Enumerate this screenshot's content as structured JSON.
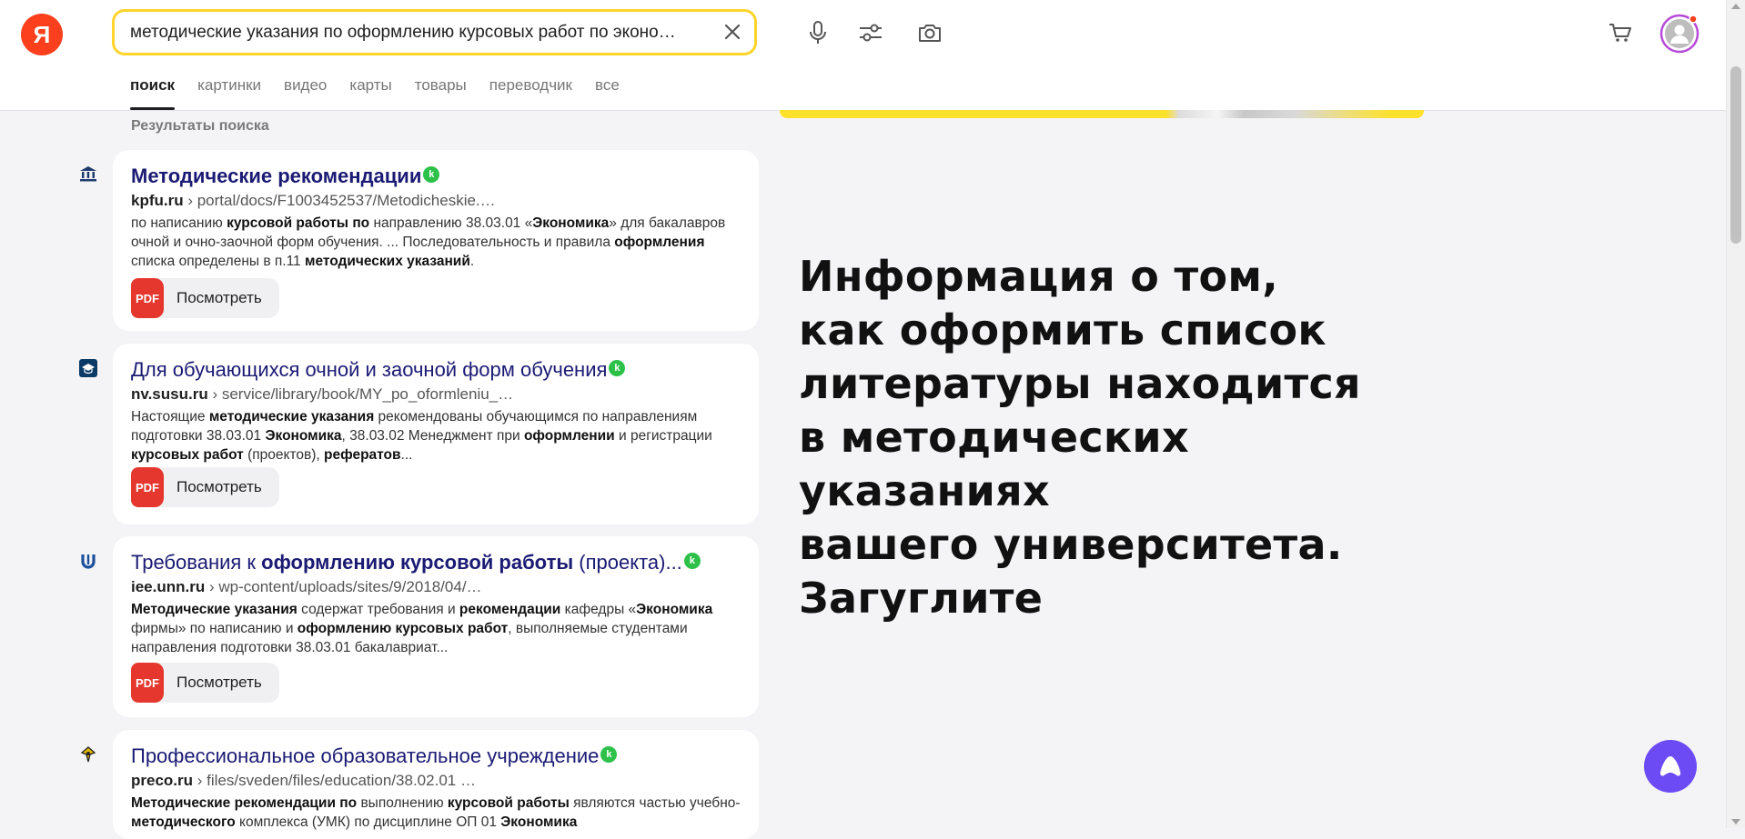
{
  "header": {
    "logo_letter": "Я",
    "search_query": "методические указания по оформлению курсовых работ по эконо…",
    "tabs": [
      "поиск",
      "картинки",
      "видео",
      "карты",
      "товары",
      "переводчик",
      "все"
    ],
    "active_tab": "поиск"
  },
  "results": {
    "heading": "Результаты поиска",
    "view_label": "Посмотреть",
    "pdf_label": "PDF",
    "badge_letter": "k",
    "items": [
      {
        "title": "Методические рекомендации",
        "domain": "kpfu.ru",
        "path": "› portal/docs/F1003452537/Metodicheskie.…",
        "snippet_parts": [
          [
            "",
            "по написанию "
          ],
          [
            "b",
            "курсовой работы по"
          ],
          [
            "",
            " направлению 38.03.01 «"
          ],
          [
            "b",
            "Экономика"
          ],
          [
            "",
            "» для бакалавров очной и очно-заочной форм обучения. ... Последовательность и правила "
          ],
          [
            "b",
            "оформления"
          ],
          [
            "",
            " списка определены в п.11 "
          ],
          [
            "b",
            "методических указаний"
          ],
          [
            "",
            "."
          ]
        ]
      },
      {
        "title": "Для обучающихся очной и заочной форм обучения",
        "domain": "nv.susu.ru",
        "path": "› service/library/book/MY_po_oformleniu_…",
        "snippet_parts": [
          [
            "",
            "Настоящие "
          ],
          [
            "b",
            "методические указания"
          ],
          [
            "",
            " рекомендованы обучающимся по направлениям подготовки 38.03.01 "
          ],
          [
            "b",
            "Экономика"
          ],
          [
            "",
            ", 38.03.02 Менеджмент при "
          ],
          [
            "b",
            "оформлении"
          ],
          [
            "",
            " и регистрации "
          ],
          [
            "b",
            "курсовых работ"
          ],
          [
            "",
            " (проектов), "
          ],
          [
            "b",
            "рефератов"
          ],
          [
            "",
            "..."
          ]
        ]
      },
      {
        "title_parts": [
          [
            "",
            "Требования к "
          ],
          [
            "b",
            "оформлению курсовой работы"
          ],
          [
            "",
            " (проекта)..."
          ]
        ],
        "domain": "iee.unn.ru",
        "path": "› wp-content/uploads/sites/9/2018/04/…",
        "snippet_parts": [
          [
            "b",
            "Методические указания"
          ],
          [
            "",
            " содержат требования и "
          ],
          [
            "b",
            "рекомендации"
          ],
          [
            "",
            " кафедры «"
          ],
          [
            "b",
            "Экономика"
          ],
          [
            "",
            " фирмы» по написанию и "
          ],
          [
            "b",
            "оформлению курсовых работ"
          ],
          [
            "",
            ", выполняемые студентами направления подготовки 38.03.01 бакалавриат..."
          ]
        ]
      },
      {
        "title": "Профессиональное образовательное учреждение",
        "domain": "preco.ru",
        "path": "› files/sveden/files/education/38.02.01 …",
        "snippet_parts": [
          [
            "b",
            "Методические рекомендации по"
          ],
          [
            "",
            " выполнению "
          ],
          [
            "b",
            "курсовой работы"
          ],
          [
            "",
            " являются частью учебно-"
          ],
          [
            "b",
            "методического"
          ],
          [
            "",
            " комплекса (УМК) по дисциплине ОП 01 "
          ],
          [
            "b",
            "Экономика"
          ]
        ]
      }
    ]
  },
  "overlay_text": "Информация о том,\nкак оформить список\nлитературы находится\nв методических указаниях\nвашего университета.\nЗагуглите",
  "colors": {
    "accent_yellow": "#fed42b",
    "logo_red": "#fc3f1d",
    "link": "#1b1a74",
    "pdf_red": "#e5372d",
    "badge_green": "#2ec14a",
    "alice_purple": "#6c4bf5"
  }
}
